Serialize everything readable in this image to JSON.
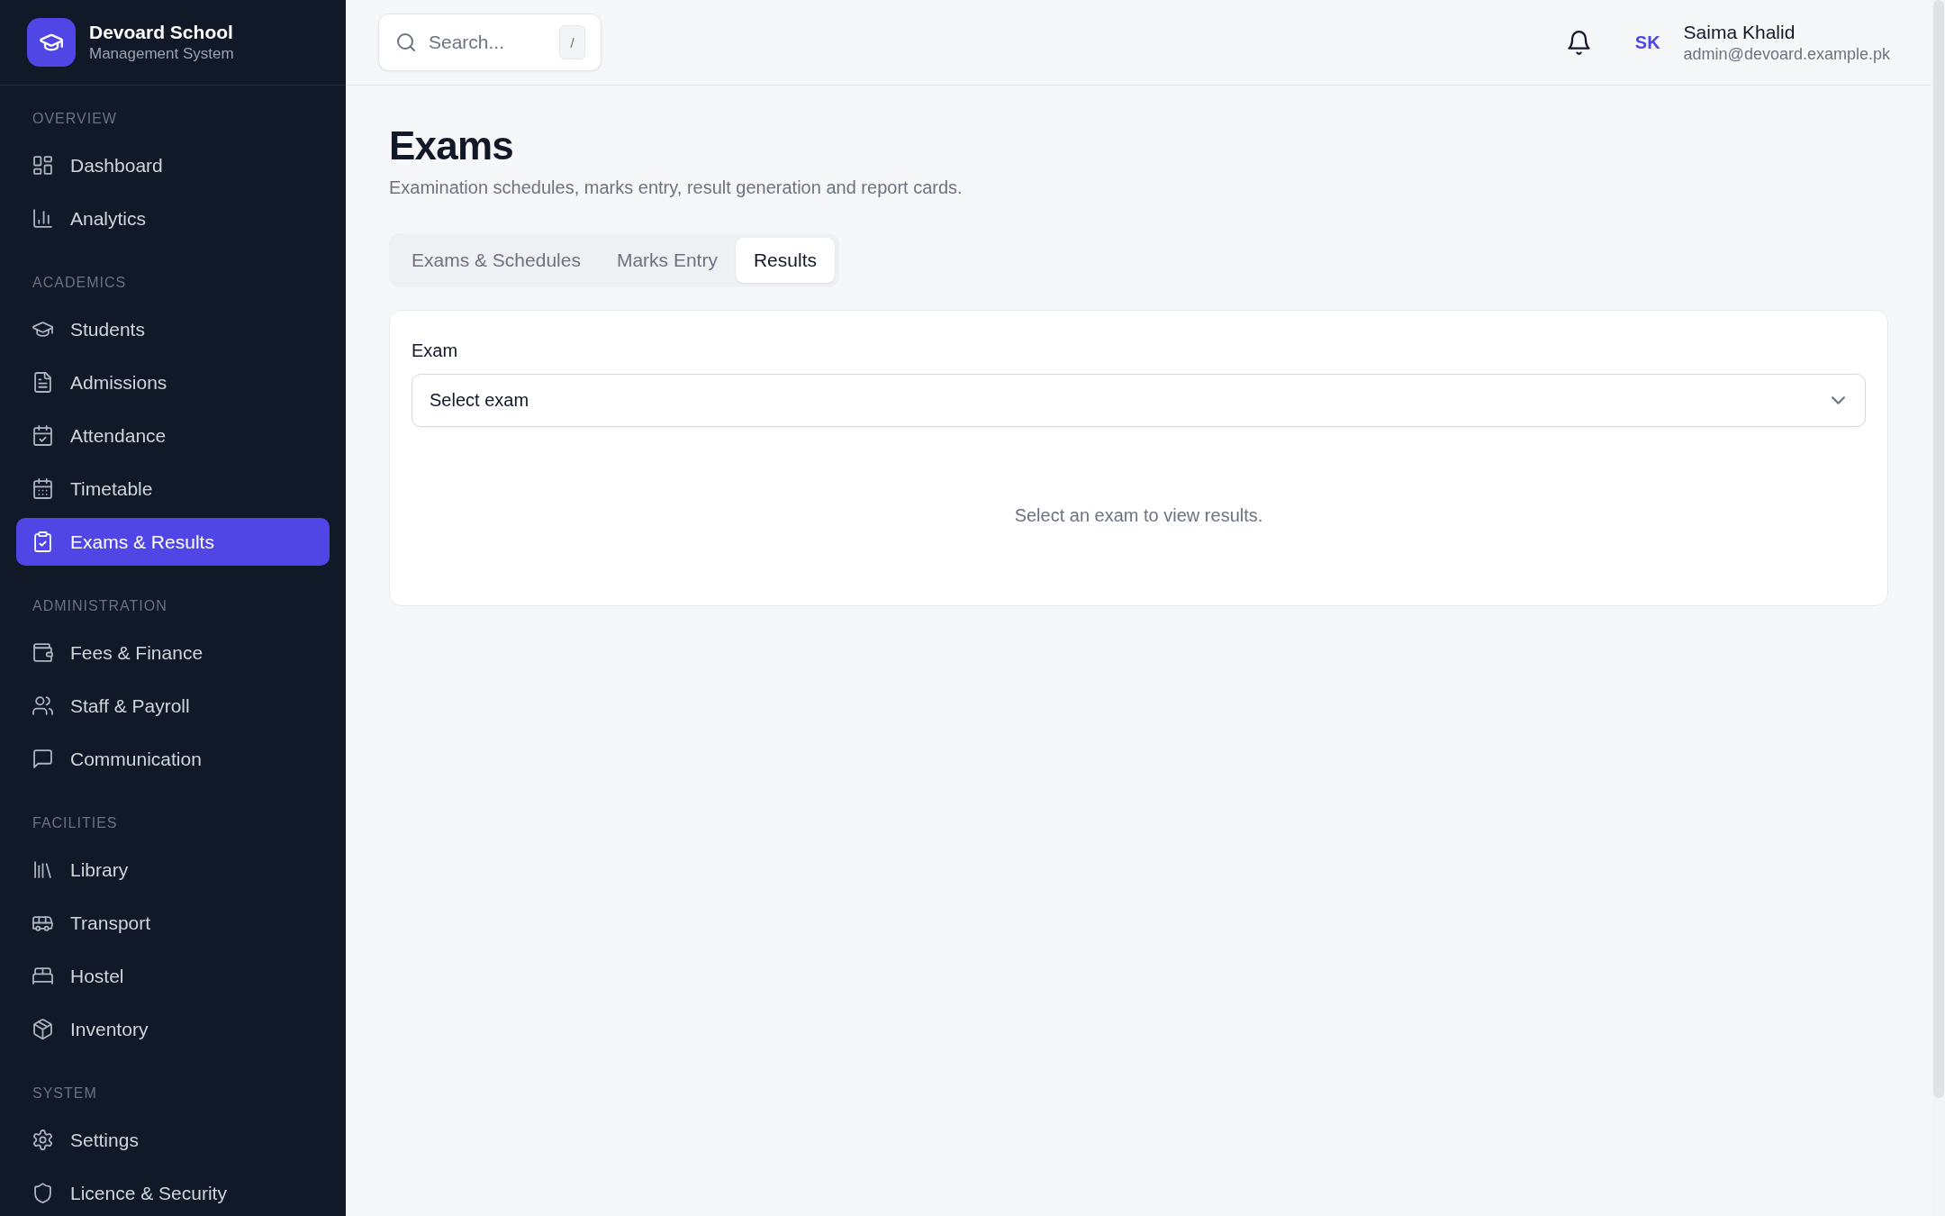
{
  "brand": {
    "name": "Devoard School",
    "subtitle": "Management System"
  },
  "sidebar": {
    "sections": [
      {
        "title": "OVERVIEW",
        "items": [
          {
            "label": "Dashboard",
            "selected": false
          },
          {
            "label": "Analytics",
            "selected": false
          }
        ]
      },
      {
        "title": "ACADEMICS",
        "items": [
          {
            "label": "Students",
            "selected": false
          },
          {
            "label": "Admissions",
            "selected": false
          },
          {
            "label": "Attendance",
            "selected": false
          },
          {
            "label": "Timetable",
            "selected": false
          },
          {
            "label": "Exams & Results",
            "selected": true
          }
        ]
      },
      {
        "title": "ADMINISTRATION",
        "items": [
          {
            "label": "Fees & Finance",
            "selected": false
          },
          {
            "label": "Staff & Payroll",
            "selected": false
          },
          {
            "label": "Communication",
            "selected": false
          }
        ]
      },
      {
        "title": "FACILITIES",
        "items": [
          {
            "label": "Library",
            "selected": false
          },
          {
            "label": "Transport",
            "selected": false
          },
          {
            "label": "Hostel",
            "selected": false
          },
          {
            "label": "Inventory",
            "selected": false
          }
        ]
      },
      {
        "title": "SYSTEM",
        "items": [
          {
            "label": "Settings",
            "selected": false
          },
          {
            "label": "Licence & Security",
            "selected": false
          }
        ]
      }
    ]
  },
  "search": {
    "placeholder": "Search...",
    "shortcut": "/"
  },
  "user": {
    "initials": "SK",
    "name": "Saima Khalid",
    "email": "admin@devoard.example.pk"
  },
  "page": {
    "title": "Exams",
    "subtitle": "Examination schedules, marks entry, result generation and report cards."
  },
  "tabs": [
    {
      "label": "Exams & Schedules",
      "selected": false
    },
    {
      "label": "Marks Entry",
      "selected": false
    },
    {
      "label": "Results",
      "selected": true
    }
  ],
  "results_card": {
    "field_label": "Exam",
    "select": {
      "value": "Select exam"
    },
    "empty_message": "Select an exam to view results."
  }
}
